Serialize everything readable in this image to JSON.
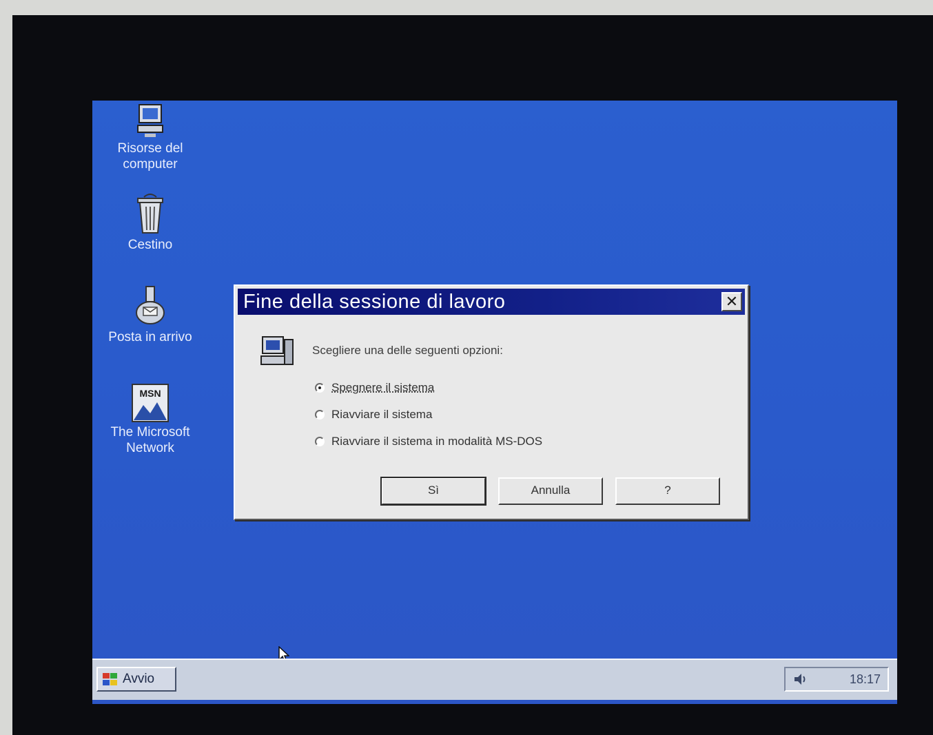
{
  "desktop": {
    "icons": [
      {
        "label": "Risorse del\ncomputer",
        "icon": "computer-icon"
      },
      {
        "label": "Cestino",
        "icon": "recycle-bin-icon"
      },
      {
        "label": "Posta in arrivo",
        "icon": "inbox-icon"
      },
      {
        "label": "The Microsoft\nNetwork",
        "icon": "msn-icon"
      }
    ]
  },
  "dialog": {
    "title": "Fine della sessione di lavoro",
    "close_glyph": "✕",
    "prompt": "Scegliere una delle seguenti opzioni:",
    "options": [
      {
        "label": "Spegnere il sistema",
        "checked": true
      },
      {
        "label": "Riavviare il sistema",
        "checked": false
      },
      {
        "label": "Riavviare il sistema in modalità MS-DOS",
        "checked": false
      }
    ],
    "buttons": {
      "yes": "Sì",
      "cancel": "Annulla",
      "help": "?"
    }
  },
  "taskbar": {
    "start_label": "Avvio",
    "clock": "18:17"
  },
  "colors": {
    "desktop": "#2b5fcf",
    "titlebar": "#0a0e6e",
    "dialog_face": "#e9e9e9",
    "taskbar": "#c9d1df"
  }
}
